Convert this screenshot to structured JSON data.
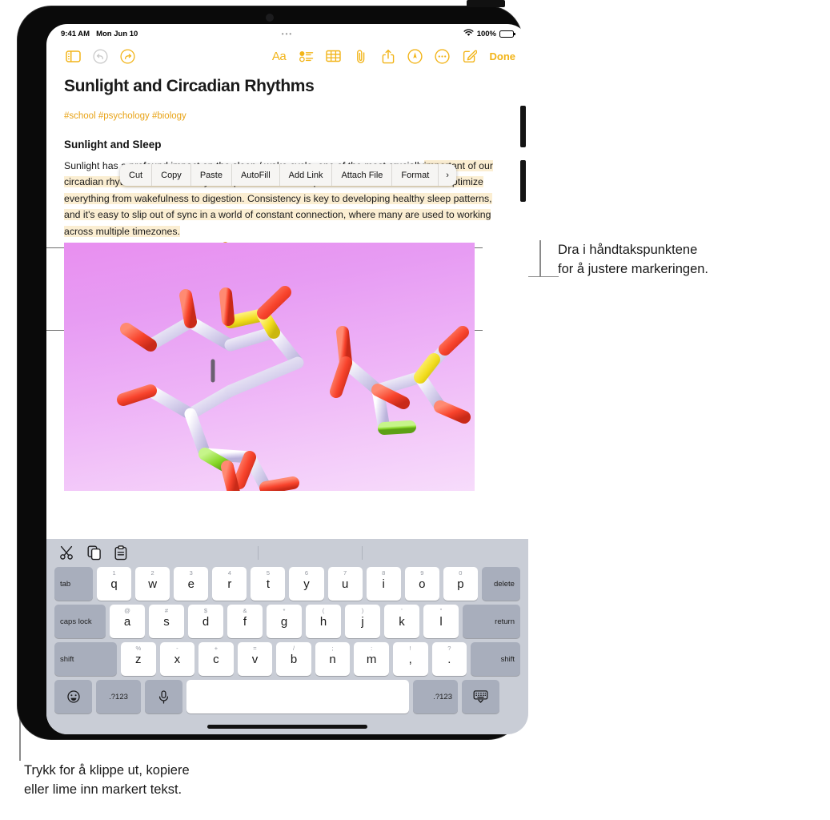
{
  "status_bar": {
    "time": "9:41 AM",
    "date": "Mon Jun 10",
    "dots": "•••",
    "battery_percent": "100%",
    "wifi_icon": "wifi-icon",
    "battery_icon": "battery-icon"
  },
  "toolbar": {
    "left_icons": [
      {
        "name": "sidebar-toggle-icon",
        "label": "Sidebar"
      },
      {
        "name": "undo-icon",
        "label": "Undo",
        "disabled": true
      },
      {
        "name": "redo-icon",
        "label": "Redo",
        "disabled": false
      }
    ],
    "right_icons": [
      {
        "name": "format-text-icon",
        "label": "Aa"
      },
      {
        "name": "checklist-icon",
        "label": "Checklist"
      },
      {
        "name": "table-icon",
        "label": "Table"
      },
      {
        "name": "attachment-icon",
        "label": "Attach"
      },
      {
        "name": "share-icon",
        "label": "Share"
      },
      {
        "name": "markup-icon",
        "label": "Markup"
      },
      {
        "name": "more-icon",
        "label": "More"
      },
      {
        "name": "compose-icon",
        "label": "New Note"
      }
    ],
    "done_label": "Done",
    "accent_color": "#F2B418"
  },
  "note": {
    "title": "Sunlight and Circadian Rhythms",
    "tags": "#school #psychology #biology",
    "heading": "Sunlight and Sleep",
    "paragraph_unselected_start": "Sunlight",
    "paragraph_hidden_line": " has a profound impact on the sleep / wake cycle, one of the most crucially",
    "paragraph_selected": "important of our circadian rhythms—a series of cyclical processes that help time our bodies' functions to optimize everything from wakefulness to digestion. Consistency is key to developing healthy sleep patterns, and it's easy to slip out of sync in a world of constant connection, where many are used to working across multiple timezones.",
    "selection_highlight_color": "#FBEED2",
    "handle_color": "#E0A51C"
  },
  "context_menu": {
    "items": [
      {
        "label": "Cut",
        "name": "context-menu-cut"
      },
      {
        "label": "Copy",
        "name": "context-menu-copy"
      },
      {
        "label": "Paste",
        "name": "context-menu-paste"
      },
      {
        "label": "AutoFill",
        "name": "context-menu-autofill"
      },
      {
        "label": "Add Link",
        "name": "context-menu-add-link"
      },
      {
        "label": "Attach File",
        "name": "context-menu-attach-file"
      },
      {
        "label": "Format",
        "name": "context-menu-format"
      },
      {
        "label": "›",
        "name": "context-menu-more-chevron"
      }
    ]
  },
  "attachment": {
    "name": "molecule-image",
    "description": "3D molecular model illustration on purple gradient background"
  },
  "keyboard": {
    "shortcut_bar": [
      {
        "name": "cut-icon",
        "label": "Cut"
      },
      {
        "name": "copy-icon",
        "label": "Copy"
      },
      {
        "name": "paste-icon",
        "label": "Paste"
      }
    ],
    "row1": [
      {
        "main": "tab",
        "sub": "",
        "mod": true
      },
      {
        "main": "q",
        "sub": "1"
      },
      {
        "main": "w",
        "sub": "2"
      },
      {
        "main": "e",
        "sub": "3"
      },
      {
        "main": "r",
        "sub": "4"
      },
      {
        "main": "t",
        "sub": "5"
      },
      {
        "main": "y",
        "sub": "6"
      },
      {
        "main": "u",
        "sub": "7"
      },
      {
        "main": "i",
        "sub": "8"
      },
      {
        "main": "o",
        "sub": "9"
      },
      {
        "main": "p",
        "sub": "0"
      },
      {
        "main": "delete",
        "sub": "",
        "mod": true
      }
    ],
    "row2": [
      {
        "main": "caps lock",
        "sub": "",
        "mod": true
      },
      {
        "main": "a",
        "sub": "@"
      },
      {
        "main": "s",
        "sub": "#"
      },
      {
        "main": "d",
        "sub": "$"
      },
      {
        "main": "f",
        "sub": "&"
      },
      {
        "main": "g",
        "sub": "*"
      },
      {
        "main": "h",
        "sub": "("
      },
      {
        "main": "j",
        "sub": ")"
      },
      {
        "main": "k",
        "sub": "'"
      },
      {
        "main": "l",
        "sub": "\""
      },
      {
        "main": "return",
        "sub": "",
        "mod": true
      }
    ],
    "row3": [
      {
        "main": "shift",
        "sub": "",
        "mod": true
      },
      {
        "main": "z",
        "sub": "%"
      },
      {
        "main": "x",
        "sub": "-"
      },
      {
        "main": "c",
        "sub": "+"
      },
      {
        "main": "v",
        "sub": "="
      },
      {
        "main": "b",
        "sub": "/"
      },
      {
        "main": "n",
        "sub": ";"
      },
      {
        "main": "m",
        "sub": ":"
      },
      {
        "main": ",",
        "sub": "!"
      },
      {
        "main": ".",
        "sub": "?"
      },
      {
        "main": "shift",
        "sub": "",
        "mod": true
      }
    ],
    "row4": [
      {
        "main": "",
        "sub": "",
        "name": "emoji-key",
        "icon": "emoji-icon"
      },
      {
        "main": ".?123",
        "sub": "",
        "name": "numeric-key-left"
      },
      {
        "main": "",
        "sub": "",
        "name": "dictation-key",
        "icon": "microphone-icon"
      },
      {
        "main": "",
        "sub": "",
        "name": "space-key"
      },
      {
        "main": ".?123",
        "sub": "",
        "name": "numeric-key-right"
      },
      {
        "main": "",
        "sub": "",
        "name": "dismiss-keyboard-key",
        "icon": "keyboard-dismiss-icon"
      }
    ]
  },
  "callouts": {
    "selection_handles": {
      "line1": "Dra i håndtakspunktene",
      "line2": "for å justere markeringen."
    },
    "shortcut_bar": {
      "line1": "Trykk for å klippe ut, kopiere",
      "line2": "eller lime inn markert tekst."
    }
  }
}
